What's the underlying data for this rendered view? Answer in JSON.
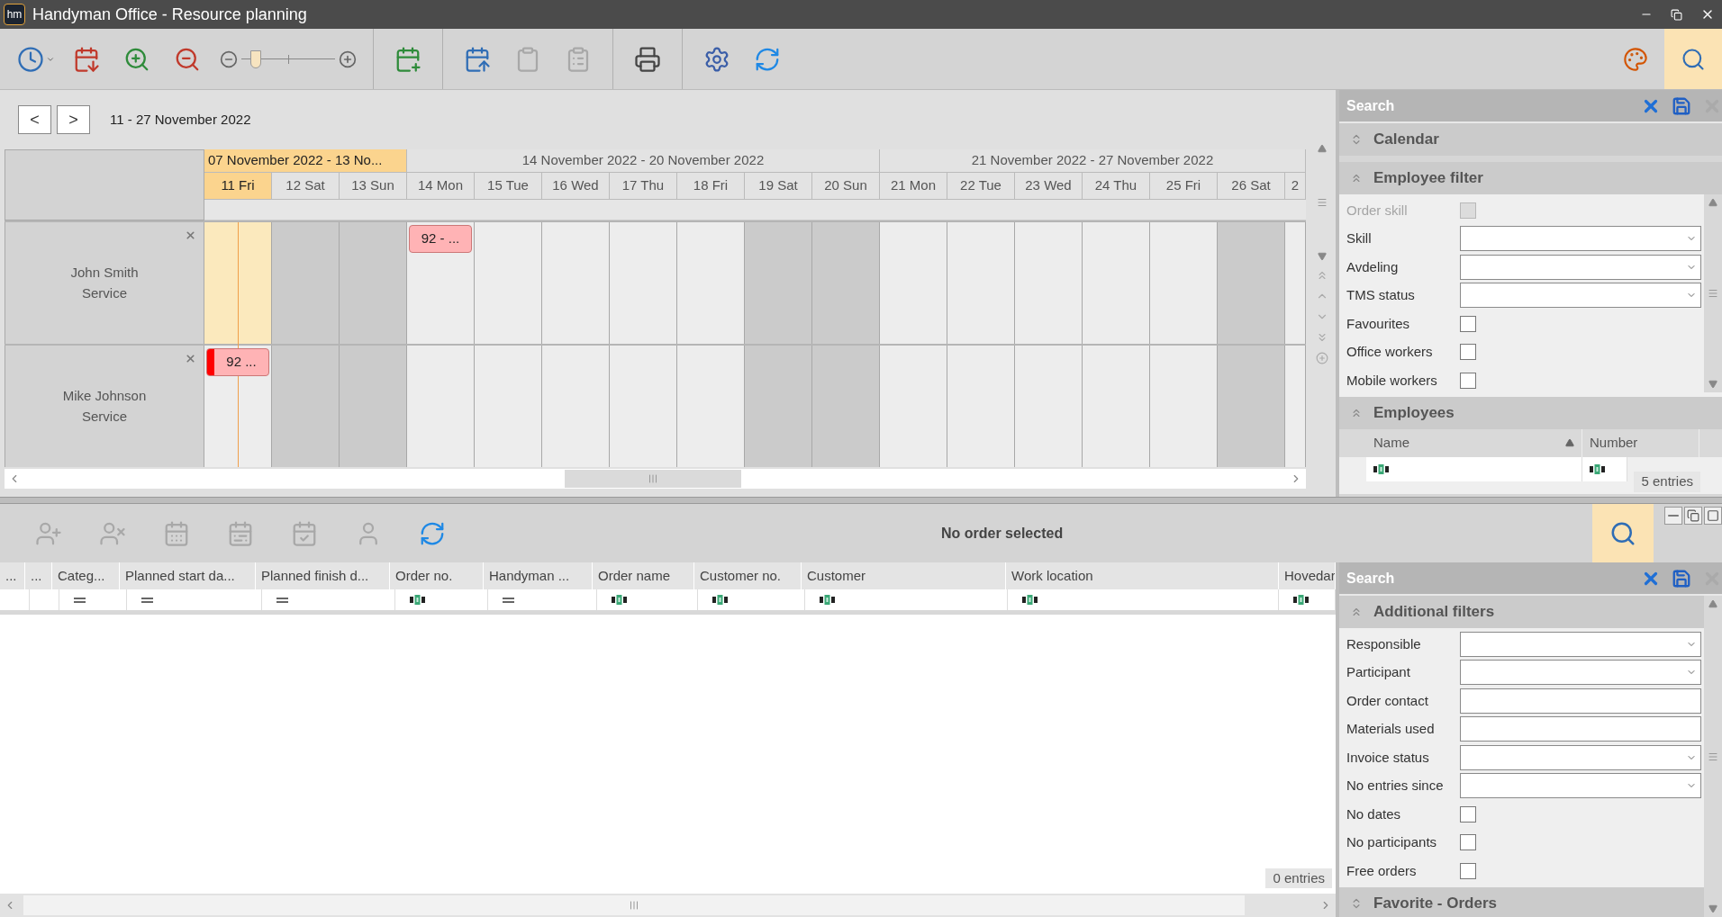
{
  "window": {
    "logo_text": "hm",
    "title": "Handyman Office - Resource planning"
  },
  "toolbar": [
    {
      "kind": "button",
      "disabled": false
    },
    {
      "kind": "button",
      "disabled": false
    },
    {
      "kind": "button",
      "disabled": false
    },
    {
      "kind": "button",
      "disabled": false
    },
    {
      "kind": "slider",
      "level": 0.15
    },
    {
      "kind": "separator"
    },
    {
      "kind": "button",
      "disabled": false
    },
    {
      "kind": "separator"
    },
    {
      "kind": "button",
      "disabled": false
    },
    {
      "kind": "button",
      "disabled": true
    },
    {
      "kind": "button",
      "disabled": true
    },
    {
      "kind": "separator"
    },
    {
      "kind": "button",
      "disabled": false
    },
    {
      "kind": "separator"
    },
    {
      "kind": "button",
      "disabled": false
    },
    {
      "kind": "button",
      "disabled": false
    }
  ],
  "toolbar_right": [
    {
      "selected": false
    },
    {
      "selected": true
    }
  ],
  "calendar": {
    "prev_label": "<",
    "next_label": ">",
    "range": "11 - 27 November 2022",
    "weeks": [
      {
        "label": "07 November 2022 - 13 No...",
        "selected": true,
        "days": [
          {
            "label": "11 Fri",
            "weekend": false,
            "selected": true
          },
          {
            "label": "12 Sat",
            "weekend": true,
            "selected": false
          },
          {
            "label": "13 Sun",
            "weekend": true,
            "selected": false
          }
        ]
      },
      {
        "label": "14 November 2022 - 20 November 2022",
        "selected": false,
        "days": [
          {
            "label": "14 Mon",
            "weekend": false,
            "selected": false
          },
          {
            "label": "15 Tue",
            "weekend": false,
            "selected": false
          },
          {
            "label": "16 Wed",
            "weekend": false,
            "selected": false
          },
          {
            "label": "17 Thu",
            "weekend": false,
            "selected": false
          },
          {
            "label": "18 Fri",
            "weekend": false,
            "selected": false
          },
          {
            "label": "19 Sat",
            "weekend": true,
            "selected": false
          },
          {
            "label": "20 Sun",
            "weekend": true,
            "selected": false
          }
        ]
      },
      {
        "label": "21 November 2022 - 27 November 2022",
        "selected": false,
        "days": [
          {
            "label": "21 Mon",
            "weekend": false,
            "selected": false
          },
          {
            "label": "22 Tue",
            "weekend": false,
            "selected": false
          },
          {
            "label": "23 Wed",
            "weekend": false,
            "selected": false
          },
          {
            "label": "24 Thu",
            "weekend": false,
            "selected": false
          },
          {
            "label": "25 Fri",
            "weekend": false,
            "selected": false
          },
          {
            "label": "26 Sat",
            "weekend": true,
            "selected": false
          },
          {
            "label": "2",
            "weekend": false,
            "selected": false
          }
        ]
      }
    ],
    "resources": [
      {
        "name": "John Smith",
        "department": "Service",
        "cells": [
          {
            "selected": true
          },
          {
            "selected": false
          },
          {
            "selected": false
          },
          {
            "selected": false,
            "appointment": {
              "label": "92 - ...",
              "flagged": false
            }
          },
          {
            "selected": false
          },
          {
            "selected": false
          },
          {
            "selected": false
          },
          {
            "selected": false
          },
          {
            "selected": false
          },
          {
            "selected": false
          },
          {
            "selected": false
          },
          {
            "selected": false
          },
          {
            "selected": false
          },
          {
            "selected": false
          },
          {
            "selected": false
          },
          {
            "selected": false
          },
          {
            "selected": false
          }
        ]
      },
      {
        "name": "Mike Johnson",
        "department": "Service",
        "cells": [
          {
            "selected": false,
            "appointment": {
              "label": "92 ...",
              "flagged": true
            }
          },
          {
            "selected": false
          },
          {
            "selected": false
          },
          {
            "selected": false
          },
          {
            "selected": false
          },
          {
            "selected": false
          },
          {
            "selected": false
          },
          {
            "selected": false
          },
          {
            "selected": false
          },
          {
            "selected": false
          },
          {
            "selected": false
          },
          {
            "selected": false
          },
          {
            "selected": false
          },
          {
            "selected": false
          },
          {
            "selected": false
          },
          {
            "selected": false
          },
          {
            "selected": false
          }
        ]
      }
    ]
  },
  "search_panel": {
    "title": "Search",
    "sections": [
      {
        "title": "Calendar",
        "expanded": false
      },
      {
        "title": "Employee filter",
        "expanded": true,
        "fields": [
          {
            "label": "Order skill",
            "kind": "checkbox",
            "checked": false,
            "disabled": true
          },
          {
            "label": "Skill",
            "kind": "dropdown",
            "disabled": false
          },
          {
            "label": "Avdeling",
            "kind": "dropdown",
            "disabled": false
          },
          {
            "label": "TMS status",
            "kind": "dropdown",
            "disabled": false
          },
          {
            "label": "Favourites",
            "kind": "checkbox",
            "checked": false,
            "disabled": false
          },
          {
            "label": "Office workers",
            "kind": "checkbox",
            "checked": false,
            "disabled": false
          },
          {
            "label": "Mobile workers",
            "kind": "checkbox",
            "checked": false,
            "disabled": false
          }
        ]
      },
      {
        "title": "Employees",
        "expanded": true,
        "table": {
          "columns": [
            {
              "label": "Name",
              "sorted": true
            },
            {
              "label": "Number",
              "sorted": false
            }
          ],
          "count": "5 entries"
        }
      }
    ]
  },
  "orders": {
    "toolbar": [
      {
        "disabled": true
      },
      {
        "disabled": true
      },
      {
        "disabled": true
      },
      {
        "disabled": true
      },
      {
        "disabled": true
      },
      {
        "disabled": true
      },
      {
        "disabled": false
      }
    ],
    "status": "No order selected",
    "search_selected": true,
    "columns": [
      {
        "label": "...",
        "kind": "plain"
      },
      {
        "label": "...",
        "kind": "plain"
      },
      {
        "label": "Categ...",
        "kind": "equals"
      },
      {
        "label": "Planned start da...",
        "kind": "equals"
      },
      {
        "label": "Planned finish d...",
        "kind": "equals"
      },
      {
        "label": "Order no.",
        "kind": "text"
      },
      {
        "label": "Handyman ...",
        "kind": "equals"
      },
      {
        "label": "Order name",
        "kind": "text"
      },
      {
        "label": "Customer no.",
        "kind": "text"
      },
      {
        "label": "Customer",
        "kind": "text"
      },
      {
        "label": "Work location",
        "kind": "text"
      },
      {
        "label": "Hovedar",
        "kind": "text"
      }
    ],
    "count": "0 entries"
  },
  "order_search_panel": {
    "title": "Search",
    "sections": [
      {
        "title": "Additional filters",
        "expanded": true,
        "fields": [
          {
            "label": "Responsible",
            "kind": "dropdown",
            "disabled": false
          },
          {
            "label": "Participant",
            "kind": "dropdown",
            "disabled": false
          },
          {
            "label": "Order contact",
            "kind": "text",
            "disabled": false
          },
          {
            "label": "Materials used",
            "kind": "text",
            "disabled": false
          },
          {
            "label": "Invoice status",
            "kind": "dropdown",
            "disabled": false
          },
          {
            "label": "No entries since",
            "kind": "dropdown",
            "disabled": false
          },
          {
            "label": "No dates",
            "kind": "checkbox",
            "checked": false,
            "disabled": false
          },
          {
            "label": "No participants",
            "kind": "checkbox",
            "checked": false,
            "disabled": false
          },
          {
            "label": "Free orders",
            "kind": "checkbox",
            "checked": false,
            "disabled": false
          }
        ]
      },
      {
        "title": "Favorite - Orders",
        "expanded": false
      }
    ]
  }
}
